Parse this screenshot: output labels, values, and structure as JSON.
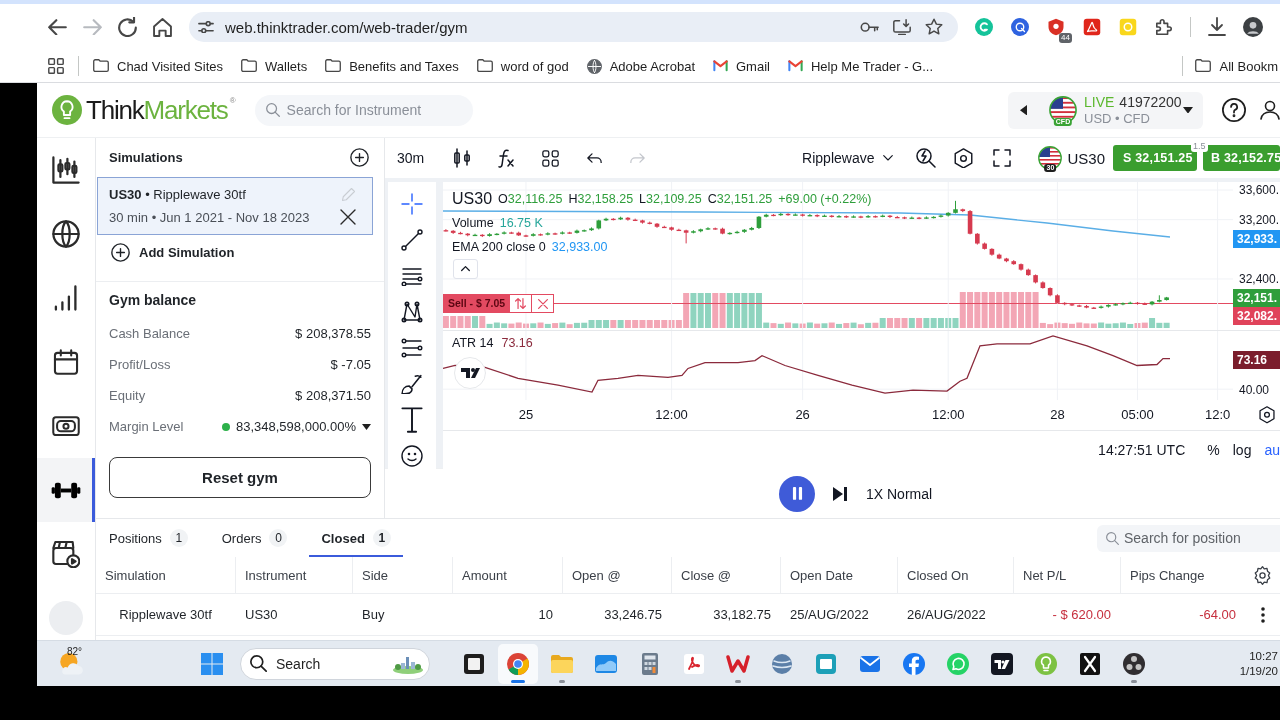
{
  "browser": {
    "nav": [
      {
        "kind": "back",
        "disabled": false
      },
      {
        "kind": "forward",
        "disabled": true
      },
      {
        "kind": "reload",
        "disabled": false
      },
      {
        "kind": "home",
        "disabled": false
      }
    ],
    "url": "web.thinktrader.com/web-trader/gym",
    "extension_badge": "44",
    "bookmarks": [
      {
        "kind": "folder",
        "label": "Chad Visited Sites"
      },
      {
        "kind": "folder",
        "label": "Wallets"
      },
      {
        "kind": "folder",
        "label": "Benefits and Taxes"
      },
      {
        "kind": "folder",
        "label": "word of god"
      },
      {
        "kind": "site",
        "label": "Adobe Acrobat"
      },
      {
        "kind": "mail",
        "label": "Gmail"
      },
      {
        "kind": "mail",
        "label": "Help Me Trader - G..."
      }
    ],
    "other_bookmarks": {
      "kind": "folder",
      "label": "All Bookm"
    }
  },
  "header": {
    "logo": {
      "first": "Think",
      "second": "Markets",
      "mark": "®"
    },
    "search": {
      "placeholder": "Search for Instrument"
    },
    "account": {
      "mode": "LIVE",
      "number": "41972200",
      "details": "USD • CFD",
      "flag_label": "CFD"
    }
  },
  "rail": [
    {
      "kind": "chart",
      "selected": false
    },
    {
      "kind": "globe",
      "selected": false
    },
    {
      "kind": "signal",
      "selected": false
    },
    {
      "kind": "calendar",
      "selected": false
    },
    {
      "kind": "cash",
      "selected": false
    },
    {
      "kind": "gym",
      "selected": true
    },
    {
      "kind": "replay",
      "selected": false
    },
    {
      "kind": "avatar",
      "selected": false
    }
  ],
  "simulations": {
    "title": "Simulations",
    "items": [
      {
        "title": "**US30** • Ripplewave 30tf",
        "details": "30 min • Jun 1 2021 - Nov 18 2023",
        "selected": true
      }
    ],
    "add_label": "Add Simulation"
  },
  "gym_balance": {
    "title": "Gym balance",
    "rows": [
      {
        "label": "Cash Balance",
        "value": "$ 208,378.55",
        "expandable": false
      },
      {
        "label": "Profit/Loss",
        "value": "$ -7.05",
        "expandable": false
      },
      {
        "label": "Equity",
        "value": "$ 208,371.50",
        "expandable": false
      },
      {
        "label": "Margin Level",
        "value": "83,348,598,000.00%",
        "color": "#2db14a",
        "expandable": true
      }
    ],
    "reset_label": "Reset gym"
  },
  "chart": {
    "toolbar": {
      "interval": "30m",
      "tools": [
        {
          "kind": "candles",
          "disabled": false
        },
        {
          "kind": "function",
          "disabled": false
        },
        {
          "kind": "layout",
          "disabled": false
        },
        {
          "kind": "undo",
          "disabled": false
        },
        {
          "kind": "redo",
          "disabled": true
        }
      ],
      "indicator": "Ripplewave",
      "symbol": "US30",
      "flag_label": "30",
      "sell": {
        "side": "S",
        "price": "32,151.25"
      },
      "spread": "1.5",
      "buy": {
        "side": "B",
        "price": "32,152.75"
      }
    },
    "drawing_tools": [
      {
        "kind": "crosshair",
        "selected": true
      },
      {
        "kind": "trend-line",
        "selected": false
      },
      {
        "kind": "horizontal-lines",
        "selected": false
      },
      {
        "kind": "pattern",
        "selected": false
      },
      {
        "kind": "fib",
        "selected": false
      },
      {
        "kind": "brush",
        "selected": false
      },
      {
        "kind": "text",
        "selected": false
      },
      {
        "kind": "emoji",
        "selected": false
      }
    ],
    "legend": {
      "symbol": "US30",
      "rising": true,
      "ohlc": [
        {
          "key": "O",
          "value": "32,116.25"
        },
        {
          "key": "H",
          "value": "32,158.25"
        },
        {
          "key": "L",
          "value": "32,109.25"
        },
        {
          "key": "C",
          "value": "32,151.25"
        }
      ],
      "change": "+69.00 (+0.22%)"
    },
    "indicators": [
      {
        "kind": "volume",
        "label": "Volume",
        "value": "16.75 K"
      },
      {
        "kind": "ema",
        "label": "EMA 200 close 0",
        "value": "32,933.00"
      }
    ],
    "position": {
      "sell": true,
      "label": "Sell - $ 7.05"
    },
    "chart_data": {
      "type": "candlestick",
      "grid": true,
      "categories": [
        null,
        null,
        null,
        null,
        null,
        null,
        null,
        null,
        null,
        null,
        null,
        "25",
        null,
        null,
        null,
        null,
        null,
        null,
        null,
        null,
        null,
        null,
        null,
        null,
        null,
        null,
        null,
        null,
        null,
        null,
        null,
        "12:00",
        null,
        null,
        null,
        null,
        null,
        null,
        null,
        null,
        null,
        null,
        null,
        null,
        null,
        null,
        null,
        null,
        null,
        "26",
        null,
        null,
        null,
        null,
        null,
        null,
        null,
        null,
        null,
        null,
        null,
        null,
        null,
        null,
        null,
        null,
        null,
        null,
        null,
        "12:00",
        null,
        null,
        null,
        null,
        null,
        null,
        null,
        null,
        null,
        null,
        null,
        null,
        null,
        null,
        "28",
        null,
        null,
        null,
        null,
        null,
        null,
        null,
        null,
        null,
        null,
        "05:00",
        null,
        null,
        null,
        null,
        null,
        null,
        null,
        null,
        null,
        null,
        "12:0"
      ],
      "ohlc": [
        [
          33058,
          33072,
          33041,
          33050
        ],
        [
          33050,
          33059,
          33008,
          33022
        ],
        [
          33022,
          33036,
          33002,
          33011
        ],
        [
          33011,
          33020,
          32976,
          32990
        ],
        [
          32990,
          33010,
          32981,
          32996
        ],
        [
          32996,
          33005,
          32966,
          32980
        ],
        [
          32980,
          33018,
          32971,
          33004
        ],
        [
          33004,
          33019,
          32990,
          33010
        ],
        [
          33010,
          33042,
          33001,
          33028
        ],
        [
          33028,
          33037,
          33010,
          33024
        ],
        [
          33024,
          33038,
          32980,
          32988
        ],
        [
          32988,
          32997,
          32968,
          32982
        ],
        [
          32982,
          33018,
          32973,
          33004
        ],
        [
          33004,
          33013,
          32984,
          32998
        ],
        [
          32998,
          33030,
          32989,
          33016
        ],
        [
          33016,
          33025,
          32996,
          33010
        ],
        [
          33010,
          33042,
          33001,
          33028
        ],
        [
          33028,
          33037,
          33008,
          33022
        ],
        [
          33022,
          33066,
          33013,
          33052
        ],
        [
          33052,
          33067,
          33038,
          33058
        ],
        [
          33058,
          33096,
          33049,
          33082
        ],
        [
          33082,
          33199,
          33068,
          33190
        ],
        [
          33190,
          33226,
          33181,
          33212
        ],
        [
          33212,
          33221,
          33190,
          33204
        ],
        [
          33204,
          33240,
          33195,
          33226
        ],
        [
          33226,
          33235,
          33186,
          33200
        ],
        [
          33200,
          33214,
          33181,
          33190
        ],
        [
          33190,
          33199,
          33146,
          33160
        ],
        [
          33160,
          33174,
          33137,
          33146
        ],
        [
          33146,
          33155,
          33090,
          33104
        ],
        [
          33104,
          33118,
          33087,
          33096
        ],
        [
          33096,
          33105,
          33050,
          33064
        ],
        [
          33064,
          33078,
          33047,
          33056
        ],
        [
          33056,
          33065,
          32880,
          33024
        ],
        [
          33024,
          33058,
          33015,
          33044
        ],
        [
          33044,
          33079,
          33030,
          33070
        ],
        [
          33070,
          33098,
          33061,
          33084
        ],
        [
          33084,
          33093,
          33064,
          33078
        ],
        [
          33078,
          33092,
          33003,
          33012
        ],
        [
          33012,
          33031,
          32998,
          33022
        ],
        [
          33022,
          33050,
          33013,
          33036
        ],
        [
          33036,
          33073,
          33022,
          33064
        ],
        [
          33064,
          33102,
          33055,
          33088
        ],
        [
          33088,
          33249,
          33074,
          33240
        ],
        [
          33240,
          33280,
          33231,
          33266
        ],
        [
          33266,
          33275,
          33246,
          33260
        ],
        [
          33260,
          33292,
          33251,
          33278
        ],
        [
          33278,
          33287,
          33252,
          33266
        ],
        [
          33266,
          33284,
          33257,
          33270
        ],
        [
          33270,
          33279,
          33242,
          33256
        ],
        [
          33256,
          33276,
          33247,
          33262
        ],
        [
          33262,
          33271,
          33234,
          33248
        ],
        [
          33248,
          33268,
          33239,
          33254
        ],
        [
          33254,
          33263,
          33228,
          33242
        ],
        [
          33242,
          33262,
          33233,
          33248
        ],
        [
          33248,
          33257,
          33222,
          33236
        ],
        [
          33236,
          33258,
          33227,
          33244
        ],
        [
          33244,
          33253,
          33220,
          33234
        ],
        [
          33234,
          33262,
          33225,
          33248
        ],
        [
          33248,
          33257,
          33228,
          33242
        ],
        [
          33242,
          33268,
          33233,
          33254
        ],
        [
          33254,
          33263,
          33222,
          33236
        ],
        [
          33236,
          33250,
          33223,
          33232
        ],
        [
          33232,
          33241,
          33208,
          33222
        ],
        [
          33222,
          33242,
          33213,
          33228
        ],
        [
          33228,
          33237,
          33206,
          33220
        ],
        [
          33220,
          33244,
          33211,
          33230
        ],
        [
          33230,
          33247,
          33216,
          33238
        ],
        [
          33238,
          33270,
          33229,
          33256
        ],
        [
          33256,
          33301,
          33242,
          33292
        ],
        [
          33292,
          33454,
          33283,
          33340
        ],
        [
          33340,
          33349,
          33302,
          33316
        ],
        [
          33316,
          33330,
          33001,
          33010
        ],
        [
          33010,
          33019,
          32864,
          32878
        ],
        [
          32878,
          32892,
          32797,
          32806
        ],
        [
          32806,
          32815,
          32714,
          32728
        ],
        [
          32728,
          32742,
          32667,
          32676
        ],
        [
          32676,
          32685,
          32626,
          32640
        ],
        [
          32640,
          32654,
          32591,
          32600
        ],
        [
          32600,
          32609,
          32512,
          32526
        ],
        [
          32526,
          32540,
          32443,
          32452
        ],
        [
          32452,
          32461,
          32340,
          32354
        ],
        [
          32354,
          32368,
          32269,
          32278
        ],
        [
          32278,
          32287,
          32166,
          32180
        ],
        [
          32180,
          32194,
          32069,
          32078
        ],
        [
          32078,
          32087,
          32046,
          32060
        ],
        [
          32060,
          32074,
          32035,
          32044
        ],
        [
          32044,
          32053,
          32022,
          32036
        ],
        [
          32036,
          32050,
          32005,
          32014
        ],
        [
          32014,
          32023,
          31996,
          32010
        ],
        [
          32010,
          32042,
          32001,
          32028
        ],
        [
          32028,
          32059,
          32014,
          32050
        ],
        [
          32050,
          32074,
          32041,
          32060
        ],
        [
          32060,
          32083,
          32046,
          32074
        ],
        [
          32074,
          32094,
          32065,
          32080
        ],
        [
          32080,
          32089,
          32054,
          32068
        ],
        [
          32068,
          32082,
          32049,
          32058
        ],
        [
          32058,
          32103,
          32044,
          32094
        ],
        [
          32094,
          32180,
          32085,
          32116.25
        ],
        [
          32116.25,
          32158.25,
          32109.25,
          32151.25
        ],
        null,
        null,
        null,
        null,
        null,
        null,
        null
      ],
      "ylim": [
        31712,
        33708
      ],
      "yticks": [
        {
          "value": 33600,
          "label": "33,600."
        },
        {
          "value": 33200,
          "label": "33,200."
        },
        {
          "value": 32400,
          "label": "32,400."
        }
      ]
    },
    "price_badges": [
      {
        "text": "32,933.",
        "color": "#2196f3"
      },
      {
        "text": "32,151.",
        "color": "#2f9e3b"
      },
      {
        "text": "32,082.",
        "color": "#e0435a"
      }
    ],
    "atr": {
      "label": "ATR 14",
      "value": "73.16"
    },
    "atr_axis": {
      "labels": [
        "40.00"
      ],
      "badges": [
        {
          "text": "73.16",
          "color": "#7b1d2c"
        }
      ]
    },
    "footer": {
      "time": "14:27:51 UTC",
      "toggles": [
        {
          "label": "%",
          "selected": false
        },
        {
          "label": "log",
          "selected": false
        },
        {
          "label": "au",
          "selected": true
        }
      ]
    }
  },
  "replay": {
    "playing": true,
    "speed": "1X Normal"
  },
  "positions": {
    "tabs": [
      {
        "label": "Positions",
        "count": "1",
        "selected": false
      },
      {
        "label": "Orders",
        "count": "0",
        "selected": false
      },
      {
        "label": "Closed",
        "count": "1",
        "selected": true
      }
    ],
    "search": {
      "placeholder": "Search for position"
    },
    "columns": [
      {
        "label": "Simulation",
        "kind": "name"
      },
      {
        "label": "Instrument",
        "kind": "text"
      },
      {
        "label": "Side",
        "kind": "text"
      },
      {
        "label": "Amount",
        "kind": "number"
      },
      {
        "label": "Open @",
        "kind": "number"
      },
      {
        "label": "Close @",
        "kind": "number"
      },
      {
        "label": "Open Date",
        "kind": "text"
      },
      {
        "label": "Closed On",
        "kind": "text"
      },
      {
        "label": "Net P/L",
        "kind": "pnl"
      },
      {
        "label": "Pips Change",
        "kind": "pnl"
      }
    ],
    "rows": [
      {
        "cells": [
          "Ripplewave 30tf",
          "US30",
          "Buy",
          "10",
          "33,246.75",
          "33,182.75",
          "25/AUG/2022",
          "26/AUG/2022",
          "- $ 620.00",
          "-64.00"
        ],
        "loss": true
      }
    ]
  },
  "taskbar": {
    "temperature": "82°",
    "search_placeholder": "Search",
    "apps": [
      {
        "kind": "task-view",
        "running": false,
        "selected": false
      },
      {
        "kind": "browser",
        "running": true,
        "selected": true
      },
      {
        "kind": "files",
        "running": true,
        "selected": false
      },
      {
        "kind": "photos",
        "running": false,
        "selected": false
      },
      {
        "kind": "calculator",
        "running": false,
        "selected": false
      },
      {
        "kind": "pdf",
        "running": false,
        "selected": false
      },
      {
        "kind": "office",
        "running": true,
        "selected": false
      },
      {
        "kind": "sphere",
        "running": false,
        "selected": false
      },
      {
        "kind": "remote",
        "running": false,
        "selected": false
      },
      {
        "kind": "mail",
        "running": false,
        "selected": false
      },
      {
        "kind": "social",
        "running": false,
        "selected": false
      },
      {
        "kind": "chat",
        "running": false,
        "selected": false
      },
      {
        "kind": "charts",
        "running": false,
        "selected": false
      },
      {
        "kind": "bulb",
        "running": false,
        "selected": false
      },
      {
        "kind": "cross",
        "running": false,
        "selected": false
      },
      {
        "kind": "recorder",
        "running": true,
        "selected": false
      }
    ],
    "time": "10:27",
    "date": "1/19/20"
  }
}
